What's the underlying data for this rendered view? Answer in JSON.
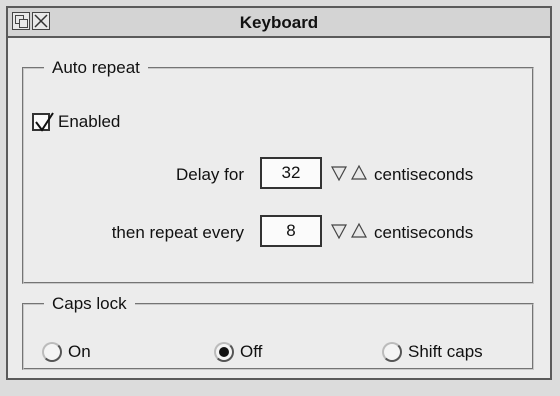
{
  "window": {
    "title": "Keyboard"
  },
  "auto_repeat": {
    "legend": "Auto repeat",
    "enabled_label": "Enabled",
    "enabled": true,
    "delay_label": "Delay for",
    "delay_value": "32",
    "delay_unit": "centiseconds",
    "repeat_label": "then repeat every",
    "repeat_value": "8",
    "repeat_unit": "centiseconds"
  },
  "caps_lock": {
    "legend": "Caps lock",
    "options": [
      {
        "label": "On",
        "selected": false
      },
      {
        "label": "Off",
        "selected": true
      },
      {
        "label": "Shift caps",
        "selected": false
      }
    ]
  },
  "icons": {
    "back": "window-back-icon",
    "close": "close-icon",
    "decrement": "down-arrow-icon",
    "increment": "up-arrow-icon",
    "check": "checkmark-icon"
  }
}
